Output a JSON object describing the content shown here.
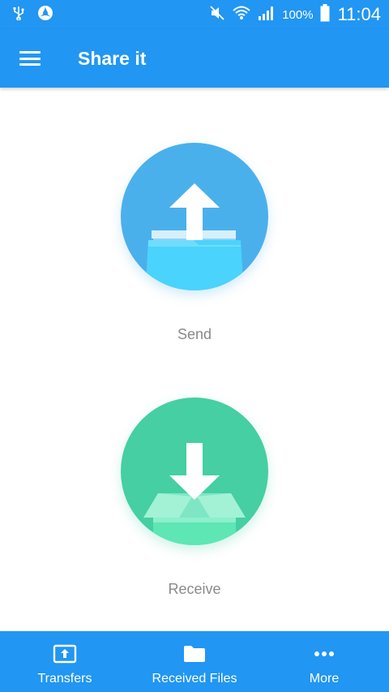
{
  "status_bar": {
    "battery_percent": "100%",
    "time": "11:04",
    "icons": [
      "usb-icon",
      "shield-icon",
      "mute-icon",
      "wifi-icon",
      "signal-icon",
      "battery-icon"
    ]
  },
  "app_bar": {
    "title": "Share it",
    "menu_icon": "menu-icon"
  },
  "actions": {
    "send": {
      "label": "Send",
      "icon": "upload-folder-icon",
      "color": "#4ab0ec"
    },
    "receive": {
      "label": "Receive",
      "icon": "download-box-icon",
      "color": "#45cfa2"
    }
  },
  "bottom_nav": {
    "items": [
      {
        "label": "Transfers",
        "icon": "transfers-icon"
      },
      {
        "label": "Received Files",
        "icon": "folder-icon"
      },
      {
        "label": "More",
        "icon": "more-dots-icon"
      }
    ]
  },
  "colors": {
    "primary": "#2196f3",
    "label_gray": "#8a8a8a"
  }
}
